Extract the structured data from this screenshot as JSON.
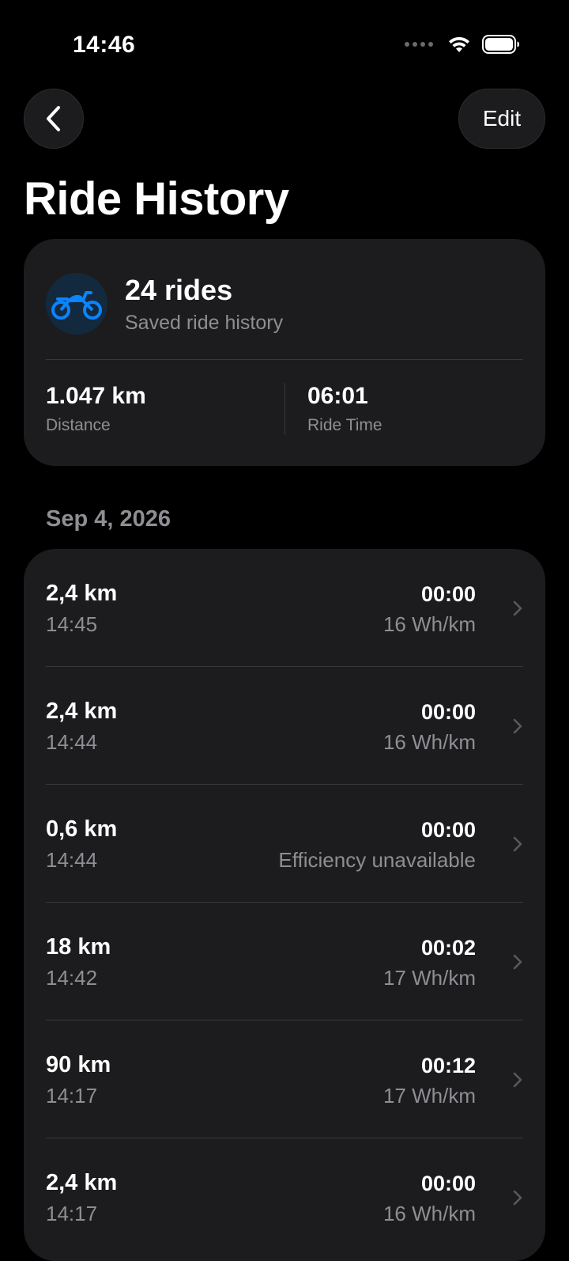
{
  "status_bar": {
    "time": "14:46",
    "icons": [
      "signal-dots-icon",
      "wifi-icon",
      "battery-icon"
    ]
  },
  "nav": {
    "back_icon": "chevron-left-icon",
    "edit_label": "Edit"
  },
  "page": {
    "title": "Ride History"
  },
  "summary": {
    "icon": "motorcycle-icon",
    "count": "24 rides",
    "subtitle": "Saved ride history",
    "stats": [
      {
        "value": "1.047 km",
        "label": "Distance"
      },
      {
        "value": "06:01",
        "label": "Ride Time"
      }
    ]
  },
  "section": {
    "date": "Sep 4, 2026"
  },
  "rides": [
    {
      "distance": "2,4 km",
      "time": "14:45",
      "duration": "00:00",
      "efficiency": "16 Wh/km"
    },
    {
      "distance": "2,4 km",
      "time": "14:44",
      "duration": "00:00",
      "efficiency": "16 Wh/km"
    },
    {
      "distance": "0,6 km",
      "time": "14:44",
      "duration": "00:00",
      "efficiency": "Efficiency unavailable"
    },
    {
      "distance": "18 km",
      "time": "14:42",
      "duration": "00:02",
      "efficiency": "17 Wh/km"
    },
    {
      "distance": "90 km",
      "time": "14:17",
      "duration": "00:12",
      "efficiency": "17 Wh/km"
    },
    {
      "distance": "2,4 km",
      "time": "14:17",
      "duration": "00:00",
      "efficiency": "16 Wh/km"
    }
  ],
  "colors": {
    "background": "#000000",
    "card": "#1c1c1e",
    "secondary_text": "#8e8e93",
    "accent": "#0a84ff",
    "icon_bg": "#13293d"
  }
}
